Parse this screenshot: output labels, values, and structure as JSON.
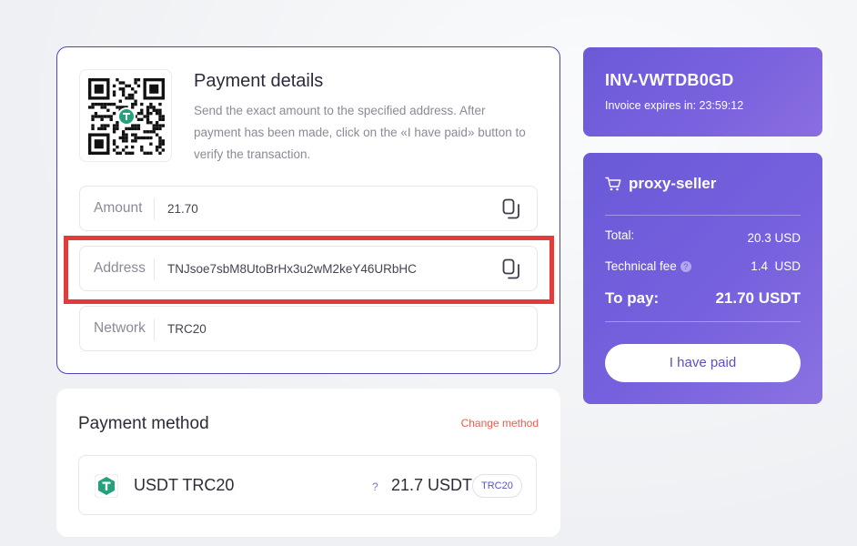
{
  "details": {
    "title": "Payment details",
    "description": "Send the exact amount to the specified address. After payment has been made, click on the «I have paid» button to verify the transaction.",
    "amount_label": "Amount",
    "amount_value": "21.70",
    "address_label": "Address",
    "address_value": "TNJsoe7sbM8UtoBrHx3u2wM2keY46URbHC",
    "network_label": "Network",
    "network_value": "TRC20"
  },
  "method": {
    "title": "Payment method",
    "change_label": "Change method",
    "name": "USDT TRC20",
    "help": "?",
    "amount": "21.7 USDT",
    "badge": "TRC20"
  },
  "invoice": {
    "id": "INV-VWTDB0GD",
    "expires": "Invoice expires in: 23:59:12"
  },
  "summary": {
    "shop": "proxy-seller",
    "total_label": "Total:",
    "total_value": "20.3 USD",
    "fee_label": "Technical fee",
    "fee_help": "?",
    "fee_value": "1.4  USD",
    "topay_label": "To pay:",
    "topay_value": "21.70 USDT",
    "paid_button": "I have paid"
  },
  "colors": {
    "accent": "#6a5ad8",
    "highlight": "#e43a3a",
    "tether": "#26a17b",
    "link": "#ee5a4a"
  },
  "icons": [
    "qr-code-icon",
    "tether-icon",
    "copy-icon",
    "cart-icon",
    "help-icon"
  ]
}
